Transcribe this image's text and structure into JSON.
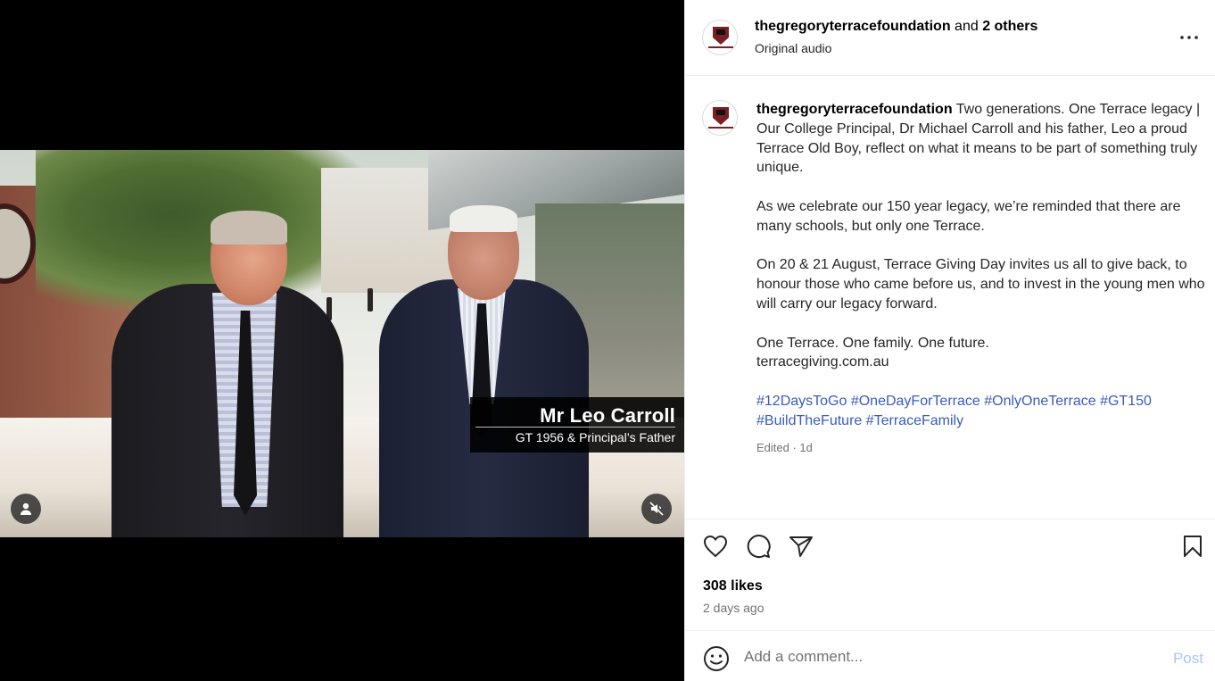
{
  "header": {
    "username": "thegregoryterracefoundation",
    "connector": " and ",
    "others": "2 others",
    "subtitle": "Original audio",
    "more_icon": "more-horizontal-icon"
  },
  "video": {
    "name_title": "Mr Leo Carroll",
    "name_subtitle": "GT 1956 & Principal’s Father",
    "tag_user_icon": "user-icon",
    "mute_icon": "speaker-muted-icon"
  },
  "caption": {
    "username": "thegregoryterracefoundation",
    "para1": " Two generations. One Terrace legacy | Our College Principal, Dr Michael Carroll and his father, Leo a proud Terrace Old Boy, reflect on what it means to be part of something truly unique.",
    "para2": "As we celebrate our 150 year legacy, we’re reminded that there are many schools, but only one Terrace.",
    "para3": "On 20 & 21 August, Terrace Giving Day invites us all to give back, to honour those who came before us, and to invest in the young men who will carry our legacy forward.",
    "para4_line1": "One Terrace. One family. One future.",
    "para4_line2": "terracegiving.com.au",
    "hashtags": "#12DaysToGo #OneDayForTerrace #OnlyOneTerrace #GT150 #BuildTheFuture #TerraceFamily",
    "edited": "Edited · 1d"
  },
  "actions": {
    "like_icon": "heart-icon",
    "comment_icon": "comment-icon",
    "share_icon": "send-icon",
    "save_icon": "bookmark-icon"
  },
  "stats": {
    "likes": "308 likes",
    "posted": "2 days ago"
  },
  "comment": {
    "emoji_icon": "emoji-icon",
    "placeholder": "Add a comment...",
    "post_label": "Post"
  },
  "colors": {
    "link": "#3a5bbf",
    "post_disabled": "#a8c7f7",
    "secondary_text": "#737373"
  }
}
